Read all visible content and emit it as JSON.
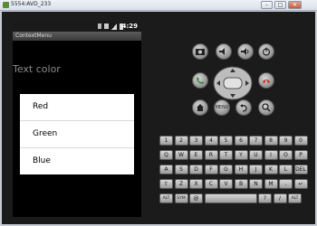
{
  "window": {
    "title": "5554:AVD_233"
  },
  "window_buttons": {
    "minimize": "–",
    "maximize": "□",
    "close": "✕"
  },
  "statusbar": {
    "time": "4:29"
  },
  "app": {
    "title": "ContextMenu",
    "main_text": "Text color"
  },
  "context_menu": {
    "items": [
      "Red",
      "Green",
      "Blue"
    ]
  },
  "controls": {
    "home_label": "MENU"
  },
  "keyboard": {
    "row1": [
      "1",
      "2",
      "3",
      "4",
      "5",
      "6",
      "7",
      "8",
      "9",
      "0"
    ],
    "row2": [
      "Q",
      "W",
      "E",
      "R",
      "T",
      "Y",
      "U",
      "I",
      "O",
      "P"
    ],
    "row3": [
      "A",
      "S",
      "D",
      "F",
      "G",
      "H",
      "J",
      "K",
      "L",
      "DEL"
    ],
    "row4": [
      "⇧",
      "Z",
      "X",
      "C",
      "V",
      "B",
      "N",
      "M",
      ".",
      "↵"
    ],
    "row5": [
      "ALT",
      "SYM",
      "@",
      "",
      "?",
      "/",
      "ALT"
    ]
  }
}
